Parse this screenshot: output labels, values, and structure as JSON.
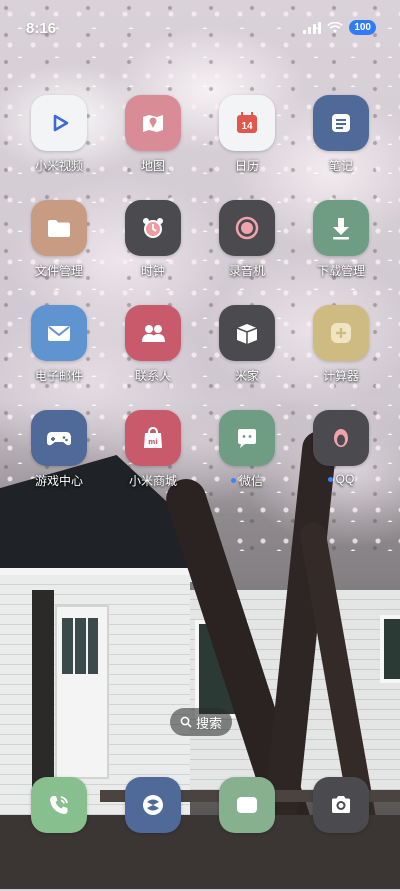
{
  "status_bar": {
    "time": "8:16",
    "battery": "100"
  },
  "apps": [
    {
      "label": "小米视频",
      "icon": "video-play-icon",
      "color": "#f3f4f6",
      "name": "app-mi-video"
    },
    {
      "label": "地图",
      "icon": "map-icon",
      "color": "#d98c96",
      "name": "app-maps"
    },
    {
      "label": "日历",
      "icon": "calendar-icon",
      "color": "#f3f4f6",
      "calendar_day": "14",
      "name": "app-calendar"
    },
    {
      "label": "笔记",
      "icon": "notes-icon",
      "color": "#4f6a99",
      "name": "app-notes"
    },
    {
      "label": "文件管理",
      "icon": "folder-icon",
      "color": "#c79c82",
      "name": "app-file-manager"
    },
    {
      "label": "时钟",
      "icon": "alarm-clock-icon",
      "color": "#4b4a4f",
      "name": "app-clock"
    },
    {
      "label": "录音机",
      "icon": "record-icon",
      "color": "#4b4a4f",
      "name": "app-recorder"
    },
    {
      "label": "下载管理",
      "icon": "download-icon",
      "color": "#6e9d84",
      "name": "app-downloads"
    },
    {
      "label": "电子邮件",
      "icon": "mail-icon",
      "color": "#5f94d0",
      "name": "app-email"
    },
    {
      "label": "联系人",
      "icon": "contacts-icon",
      "color": "#c85a6b",
      "name": "app-contacts"
    },
    {
      "label": "米家",
      "icon": "box-icon",
      "color": "#4b4a4f",
      "name": "app-mijia"
    },
    {
      "label": "计算器",
      "icon": "calculator-icon",
      "color": "#cdbb82",
      "name": "app-calculator"
    },
    {
      "label": "游戏中心",
      "icon": "gamepad-icon",
      "color": "#4f6a99",
      "name": "app-game-center"
    },
    {
      "label": "小米商城",
      "icon": "shopping-bag-icon",
      "color": "#c85a6b",
      "name": "app-mi-store"
    },
    {
      "label": "微信",
      "icon": "chat-bubble-icon",
      "color": "#6e9d84",
      "dot": true,
      "name": "app-wechat"
    },
    {
      "label": "QQ",
      "icon": "penguin-icon",
      "color": "#4b4a4f",
      "dot": true,
      "name": "app-qq"
    }
  ],
  "search": {
    "label": "搜索"
  },
  "dock": [
    {
      "icon": "phone-icon",
      "color": "#87c08e",
      "name": "dock-phone"
    },
    {
      "icon": "browser-icon",
      "color": "#4f6a99",
      "name": "dock-browser"
    },
    {
      "icon": "message-icon",
      "color": "#87b08e",
      "name": "dock-messages"
    },
    {
      "icon": "camera-icon",
      "color": "#4b4a4f",
      "name": "dock-camera"
    }
  ]
}
